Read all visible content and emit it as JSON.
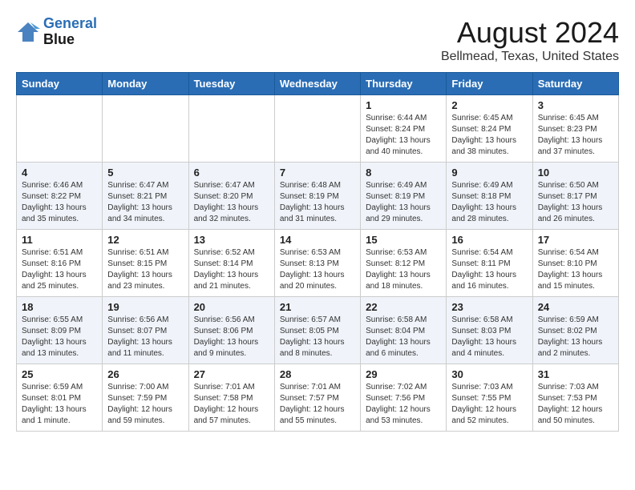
{
  "header": {
    "logo_line1": "General",
    "logo_line2": "Blue",
    "month_year": "August 2024",
    "location": "Bellmead, Texas, United States"
  },
  "days_of_week": [
    "Sunday",
    "Monday",
    "Tuesday",
    "Wednesday",
    "Thursday",
    "Friday",
    "Saturday"
  ],
  "weeks": [
    [
      {
        "day": "",
        "info": ""
      },
      {
        "day": "",
        "info": ""
      },
      {
        "day": "",
        "info": ""
      },
      {
        "day": "",
        "info": ""
      },
      {
        "day": "1",
        "info": "Sunrise: 6:44 AM\nSunset: 8:24 PM\nDaylight: 13 hours\nand 40 minutes."
      },
      {
        "day": "2",
        "info": "Sunrise: 6:45 AM\nSunset: 8:24 PM\nDaylight: 13 hours\nand 38 minutes."
      },
      {
        "day": "3",
        "info": "Sunrise: 6:45 AM\nSunset: 8:23 PM\nDaylight: 13 hours\nand 37 minutes."
      }
    ],
    [
      {
        "day": "4",
        "info": "Sunrise: 6:46 AM\nSunset: 8:22 PM\nDaylight: 13 hours\nand 35 minutes."
      },
      {
        "day": "5",
        "info": "Sunrise: 6:47 AM\nSunset: 8:21 PM\nDaylight: 13 hours\nand 34 minutes."
      },
      {
        "day": "6",
        "info": "Sunrise: 6:47 AM\nSunset: 8:20 PM\nDaylight: 13 hours\nand 32 minutes."
      },
      {
        "day": "7",
        "info": "Sunrise: 6:48 AM\nSunset: 8:19 PM\nDaylight: 13 hours\nand 31 minutes."
      },
      {
        "day": "8",
        "info": "Sunrise: 6:49 AM\nSunset: 8:19 PM\nDaylight: 13 hours\nand 29 minutes."
      },
      {
        "day": "9",
        "info": "Sunrise: 6:49 AM\nSunset: 8:18 PM\nDaylight: 13 hours\nand 28 minutes."
      },
      {
        "day": "10",
        "info": "Sunrise: 6:50 AM\nSunset: 8:17 PM\nDaylight: 13 hours\nand 26 minutes."
      }
    ],
    [
      {
        "day": "11",
        "info": "Sunrise: 6:51 AM\nSunset: 8:16 PM\nDaylight: 13 hours\nand 25 minutes."
      },
      {
        "day": "12",
        "info": "Sunrise: 6:51 AM\nSunset: 8:15 PM\nDaylight: 13 hours\nand 23 minutes."
      },
      {
        "day": "13",
        "info": "Sunrise: 6:52 AM\nSunset: 8:14 PM\nDaylight: 13 hours\nand 21 minutes."
      },
      {
        "day": "14",
        "info": "Sunrise: 6:53 AM\nSunset: 8:13 PM\nDaylight: 13 hours\nand 20 minutes."
      },
      {
        "day": "15",
        "info": "Sunrise: 6:53 AM\nSunset: 8:12 PM\nDaylight: 13 hours\nand 18 minutes."
      },
      {
        "day": "16",
        "info": "Sunrise: 6:54 AM\nSunset: 8:11 PM\nDaylight: 13 hours\nand 16 minutes."
      },
      {
        "day": "17",
        "info": "Sunrise: 6:54 AM\nSunset: 8:10 PM\nDaylight: 13 hours\nand 15 minutes."
      }
    ],
    [
      {
        "day": "18",
        "info": "Sunrise: 6:55 AM\nSunset: 8:09 PM\nDaylight: 13 hours\nand 13 minutes."
      },
      {
        "day": "19",
        "info": "Sunrise: 6:56 AM\nSunset: 8:07 PM\nDaylight: 13 hours\nand 11 minutes."
      },
      {
        "day": "20",
        "info": "Sunrise: 6:56 AM\nSunset: 8:06 PM\nDaylight: 13 hours\nand 9 minutes."
      },
      {
        "day": "21",
        "info": "Sunrise: 6:57 AM\nSunset: 8:05 PM\nDaylight: 13 hours\nand 8 minutes."
      },
      {
        "day": "22",
        "info": "Sunrise: 6:58 AM\nSunset: 8:04 PM\nDaylight: 13 hours\nand 6 minutes."
      },
      {
        "day": "23",
        "info": "Sunrise: 6:58 AM\nSunset: 8:03 PM\nDaylight: 13 hours\nand 4 minutes."
      },
      {
        "day": "24",
        "info": "Sunrise: 6:59 AM\nSunset: 8:02 PM\nDaylight: 13 hours\nand 2 minutes."
      }
    ],
    [
      {
        "day": "25",
        "info": "Sunrise: 6:59 AM\nSunset: 8:01 PM\nDaylight: 13 hours\nand 1 minute."
      },
      {
        "day": "26",
        "info": "Sunrise: 7:00 AM\nSunset: 7:59 PM\nDaylight: 12 hours\nand 59 minutes."
      },
      {
        "day": "27",
        "info": "Sunrise: 7:01 AM\nSunset: 7:58 PM\nDaylight: 12 hours\nand 57 minutes."
      },
      {
        "day": "28",
        "info": "Sunrise: 7:01 AM\nSunset: 7:57 PM\nDaylight: 12 hours\nand 55 minutes."
      },
      {
        "day": "29",
        "info": "Sunrise: 7:02 AM\nSunset: 7:56 PM\nDaylight: 12 hours\nand 53 minutes."
      },
      {
        "day": "30",
        "info": "Sunrise: 7:03 AM\nSunset: 7:55 PM\nDaylight: 12 hours\nand 52 minutes."
      },
      {
        "day": "31",
        "info": "Sunrise: 7:03 AM\nSunset: 7:53 PM\nDaylight: 12 hours\nand 50 minutes."
      }
    ]
  ]
}
